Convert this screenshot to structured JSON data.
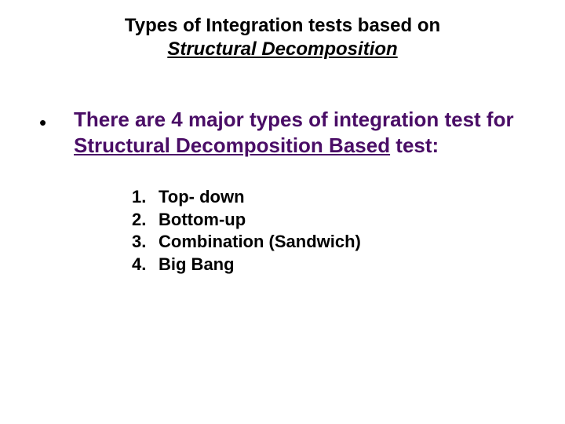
{
  "title": {
    "line1": "Types of Integration tests based on",
    "line2": "Structural Decomposition"
  },
  "bullet": {
    "mark": "•",
    "pre": "There are 4 major types of integration test for ",
    "underlined": "Structural Decomposition Based",
    "post": " test:"
  },
  "items": [
    {
      "num": "1.",
      "label": "Top- down"
    },
    {
      "num": "2.",
      "label": "Bottom-up"
    },
    {
      "num": "3.",
      "label": "Combination (Sandwich)"
    },
    {
      "num": "4.",
      "label": "Big Bang"
    }
  ]
}
